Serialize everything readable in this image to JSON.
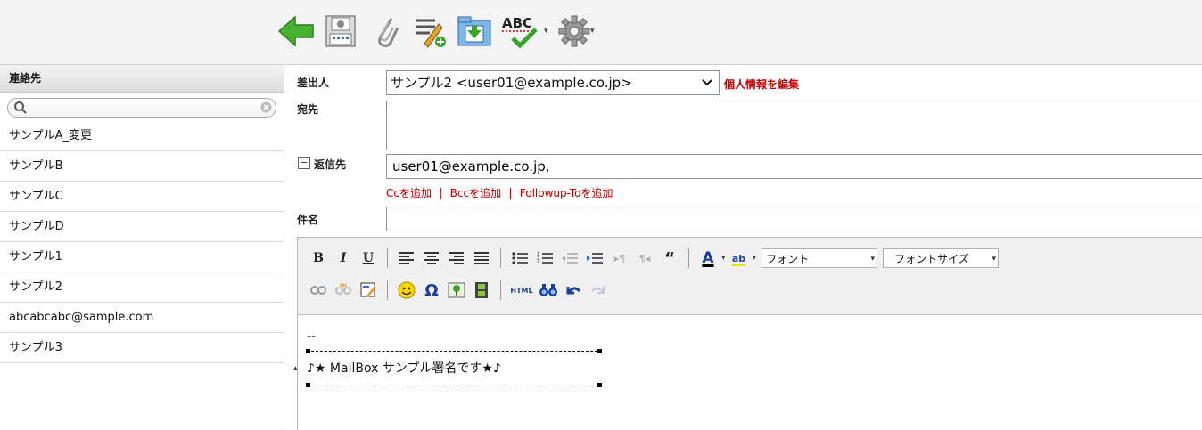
{
  "toolbar": {
    "buttons": [
      "back-arrow-icon",
      "save-draft-icon",
      "attach-icon",
      "signature-icon",
      "save-folder-icon",
      "spellcheck-icon",
      "settings-icon"
    ],
    "spell_label": "ABC",
    "dropdown_glyph": "▾"
  },
  "sidebar": {
    "title": "連絡先",
    "search_value": "",
    "contacts": [
      "サンプルA_変更",
      "サンプルB",
      "サンプルC",
      "サンプルD",
      "サンプル1",
      "サンプル2",
      "abcabcabc@sample.com",
      "サンプル3"
    ]
  },
  "compose": {
    "from_label": "差出人",
    "from_value": "サンプル2 <user01@example.co.jp>",
    "edit_profile": "個人情報を編集",
    "to_label": "宛先",
    "to_value": "",
    "reply_toggle": "−",
    "reply_label": "返信先",
    "reply_value": "user01@example.co.jp,",
    "add_cc": "Ccを追加",
    "add_bcc": "Bccを追加",
    "add_followup": "Followup-Toを追加",
    "sep": "|",
    "subject_label": "件名",
    "subject_value": ""
  },
  "editor": {
    "bold": "B",
    "italic": "I",
    "underline": "U",
    "font_select": "フォント",
    "size_select": "フォントサイズ",
    "html_label": "HTML",
    "omega": "Ω",
    "quote": "“",
    "fontcolor": "A",
    "highlight": "ab",
    "body_line1": "--",
    "signature": "♪★ MailBox サンプル署名です★♪"
  },
  "colors": {
    "accent_red": "#c00000",
    "arrow_green": "#3aa32b"
  }
}
